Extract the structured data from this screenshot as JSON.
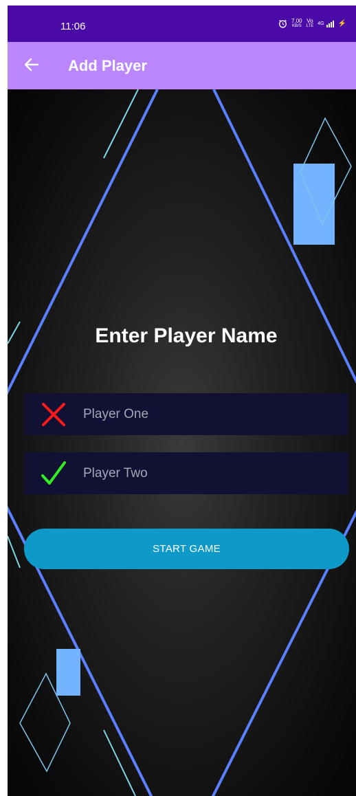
{
  "status_bar": {
    "time": "11:06",
    "icons": [
      "alarm-icon",
      "network-speed-icon",
      "volte-icon",
      "signal-icon",
      "charging-icon"
    ],
    "speed_value": "7.00",
    "speed_unit": "KB/S",
    "volte_top": "Vo",
    "volte_bottom": "LTE",
    "network_type": "4G",
    "charging_glyph": "⚡"
  },
  "app_bar": {
    "back_icon": "arrow-left-icon",
    "title": "Add Player",
    "color": "#bb86fc"
  },
  "main": {
    "heading": "Enter Player Name",
    "fields": [
      {
        "placeholder": "Player One",
        "value": "",
        "status_icon": "cross-icon",
        "status_color": "#ff1a1a"
      },
      {
        "placeholder": "Player Two",
        "value": "",
        "status_icon": "check-icon",
        "status_color": "#33ee22"
      }
    ],
    "start_button_label": "START GAME",
    "button_color": "#0d9ac9"
  }
}
